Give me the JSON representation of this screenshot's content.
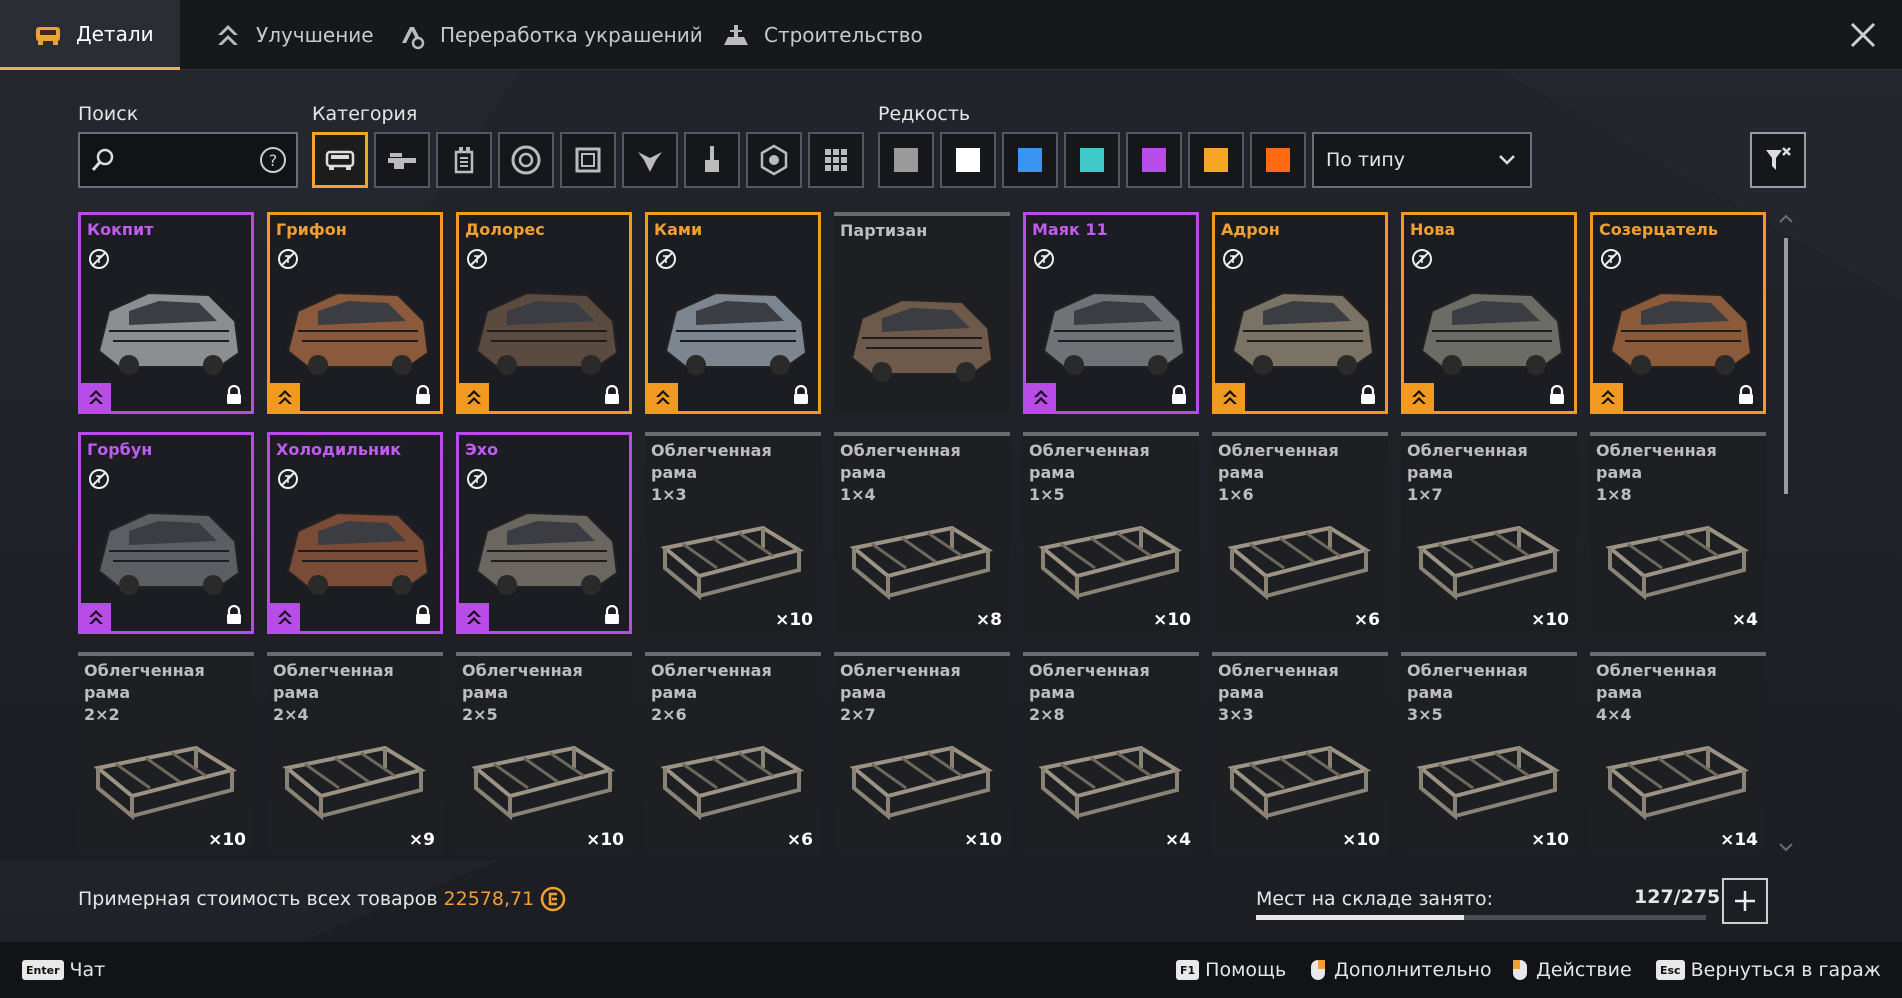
{
  "tabs": [
    {
      "label": "Детали",
      "icon": "car-icon",
      "active": true
    },
    {
      "label": "Улучшение",
      "icon": "upgrade-chevrons-icon",
      "active": false
    },
    {
      "label": "Переработка украшений",
      "icon": "recycle-decor-icon",
      "active": false
    },
    {
      "label": "Строительство",
      "icon": "construction-icon",
      "active": false
    }
  ],
  "filters": {
    "search_label": "Поиск",
    "search_value": "",
    "category_label": "Категория",
    "categories": [
      "cabin-icon",
      "weapon-icon",
      "engine-icon",
      "wheel-icon",
      "frame-icon",
      "decor-icon",
      "paint-icon",
      "module-icon",
      "all-grid-icon"
    ],
    "rarity_label": "Редкость",
    "rarity_colors": [
      "#9a9a9a",
      "#ffffff",
      "#3a95f2",
      "#3fc8c8",
      "#b84ce8",
      "#f5a623",
      "#ff6a13"
    ],
    "sort_value": "По типу"
  },
  "items": [
    {
      "name": "Кокпит",
      "rarity": "purple",
      "locked": true,
      "qty": ""
    },
    {
      "name": "Грифон",
      "rarity": "orange",
      "locked": true,
      "qty": ""
    },
    {
      "name": "Долорес",
      "rarity": "orange",
      "locked": true,
      "qty": ""
    },
    {
      "name": "Ками",
      "rarity": "orange",
      "locked": true,
      "qty": ""
    },
    {
      "name": "Партизан",
      "rarity": "gray",
      "locked": false,
      "qty": ""
    },
    {
      "name": "Маяк 11",
      "rarity": "purple",
      "locked": true,
      "qty": ""
    },
    {
      "name": "Адрон",
      "rarity": "orange",
      "locked": true,
      "qty": ""
    },
    {
      "name": "Нова",
      "rarity": "orange",
      "locked": true,
      "qty": ""
    },
    {
      "name": "Созерцатель",
      "rarity": "orange",
      "locked": true,
      "qty": ""
    },
    {
      "name": "Горбун",
      "rarity": "purple",
      "locked": true,
      "qty": ""
    },
    {
      "name": "Холодильник",
      "rarity": "purple",
      "locked": true,
      "qty": ""
    },
    {
      "name": "Эхо",
      "rarity": "purple",
      "locked": true,
      "qty": ""
    },
    {
      "name": "Облегченная рама\n1×3",
      "rarity": "gray",
      "locked": false,
      "qty": "×10"
    },
    {
      "name": "Облегченная рама\n1×4",
      "rarity": "gray",
      "locked": false,
      "qty": "×8"
    },
    {
      "name": "Облегченная рама\n1×5",
      "rarity": "gray",
      "locked": false,
      "qty": "×10"
    },
    {
      "name": "Облегченная рама\n1×6",
      "rarity": "gray",
      "locked": false,
      "qty": "×6"
    },
    {
      "name": "Облегченная рама\n1×7",
      "rarity": "gray",
      "locked": false,
      "qty": "×10"
    },
    {
      "name": "Облегченная рама\n1×8",
      "rarity": "gray",
      "locked": false,
      "qty": "×4"
    },
    {
      "name": "Облегченная рама\n2×2",
      "rarity": "gray",
      "locked": false,
      "qty": "×10"
    },
    {
      "name": "Облегченная рама\n2×4",
      "rarity": "gray",
      "locked": false,
      "qty": "×9"
    },
    {
      "name": "Облегченная рама\n2×5",
      "rarity": "gray",
      "locked": false,
      "qty": "×10"
    },
    {
      "name": "Облегченная рама\n2×6",
      "rarity": "gray",
      "locked": false,
      "qty": "×6"
    },
    {
      "name": "Облегченная рама\n2×7",
      "rarity": "gray",
      "locked": false,
      "qty": "×10"
    },
    {
      "name": "Облегченная рама\n2×8",
      "rarity": "gray",
      "locked": false,
      "qty": "×4"
    },
    {
      "name": "Облегченная рама\n3×3",
      "rarity": "gray",
      "locked": false,
      "qty": "×10"
    },
    {
      "name": "Облегченная рама\n3×5",
      "rarity": "gray",
      "locked": false,
      "qty": "×10"
    },
    {
      "name": "Облегченная рама\n4×4",
      "rarity": "gray",
      "locked": false,
      "qty": "×14"
    }
  ],
  "summary": {
    "cost_label": "Примерная стоимость всех товаров",
    "cost_value": "22578,71",
    "storage_label": "Мест на складе занято:",
    "storage_value": "127/275",
    "storage_fraction": 0.4618
  },
  "footer": {
    "chat_key": "Enter",
    "chat_label": "Чат",
    "help_key": "F1",
    "help_label": "Помощь",
    "extra_label": "Дополнительно",
    "action_label": "Действие",
    "back_key": "Esc",
    "back_label": "Вернуться в гараж"
  },
  "colors": {
    "orange": "#f29a20",
    "purple": "#b84ce8",
    "gray": "#6a6c70",
    "accent": "#f0a032"
  }
}
